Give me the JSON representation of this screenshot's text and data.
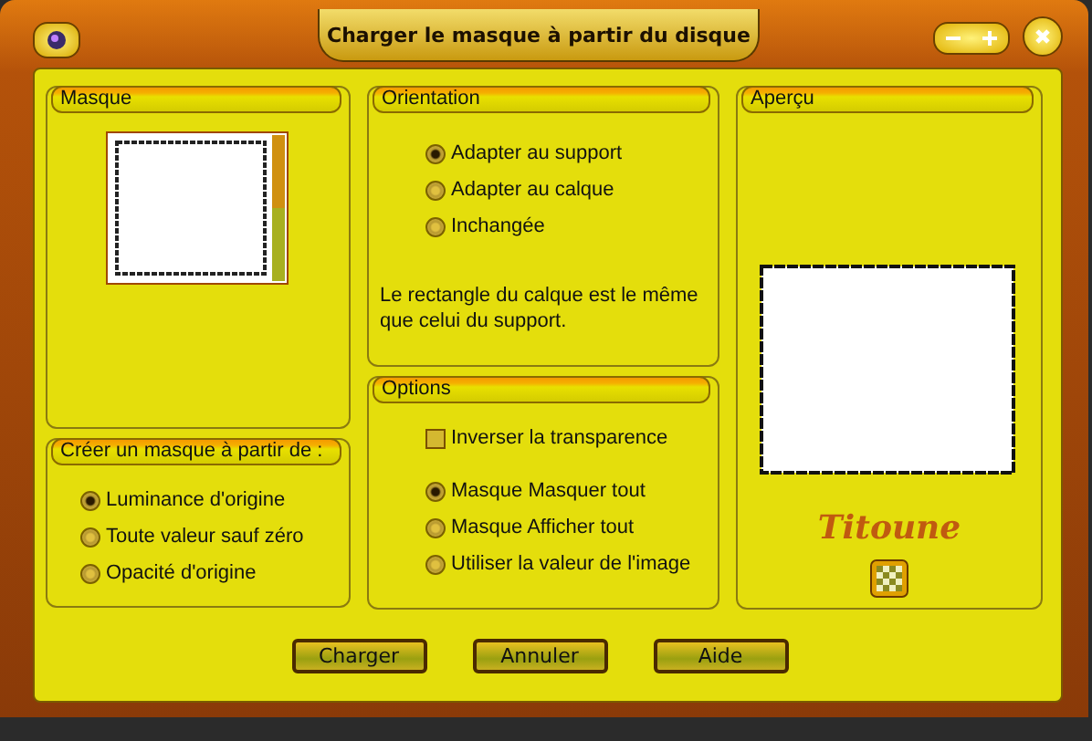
{
  "window": {
    "title": "Charger le masque à partir du disque"
  },
  "mask_group": {
    "title": "Masque"
  },
  "create_group": {
    "title": "Créer un masque à partir de :",
    "options": [
      {
        "label": "Luminance d'origine",
        "selected": true
      },
      {
        "label": "Toute valeur sauf zéro",
        "selected": false
      },
      {
        "label": "Opacité d'origine",
        "selected": false
      }
    ]
  },
  "orientation": {
    "title": "Orientation",
    "options": [
      {
        "label": "Adapter au support",
        "selected": true
      },
      {
        "label": "Adapter au calque",
        "selected": false
      },
      {
        "label": "Inchangée",
        "selected": false
      }
    ],
    "note": "Le rectangle du calque est le même que celui du support."
  },
  "options_group": {
    "title": "Options",
    "checkbox": {
      "label": "Inverser la transparence",
      "checked": false
    },
    "options": [
      {
        "label": "Masque Masquer tout",
        "selected": true
      },
      {
        "label": "Masque Afficher tout",
        "selected": false
      },
      {
        "label": "Utiliser la valeur de l'image",
        "selected": false
      }
    ]
  },
  "preview": {
    "title": "Aperçu",
    "signature": "Titoune"
  },
  "buttons": [
    "Charger",
    "Annuler",
    "Aide"
  ]
}
